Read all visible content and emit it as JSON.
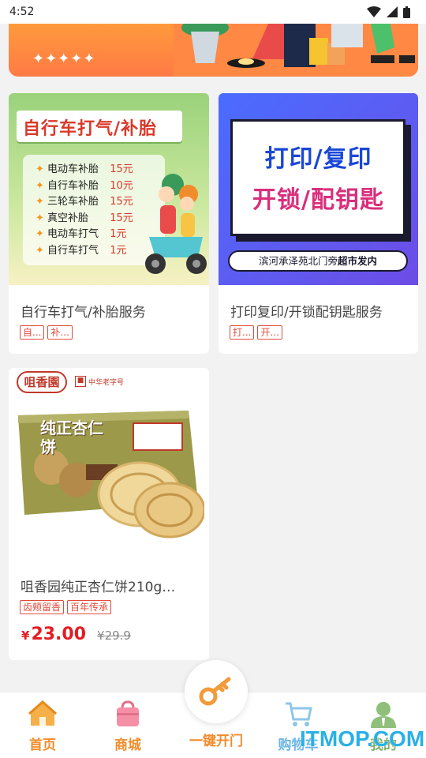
{
  "status_bar": {
    "time": "4:52"
  },
  "banner": {
    "decoration": "✦✦✦✦✦"
  },
  "products": [
    {
      "image_heading": "自行车打气/补胎",
      "price_list": [
        {
          "item": "电动车补胎",
          "price": "15元"
        },
        {
          "item": "自行车补胎",
          "price": "10元"
        },
        {
          "item": "三轮车补胎",
          "price": "15元"
        },
        {
          "item": "真空补胎",
          "price": "15元"
        },
        {
          "item": "电动车打气",
          "price": "1元"
        },
        {
          "item": "自行车打气",
          "price": "1元"
        }
      ],
      "title": "自行车打气/补胎服务",
      "tags": [
        "自...",
        "补..."
      ]
    },
    {
      "image_line1": "打印/复印",
      "image_line2": "开锁/配钥匙",
      "image_footer": "滨河承泽苑北门旁",
      "image_footer_bold": "超市发内",
      "title": "打印复印/开锁配钥匙服务",
      "tags": [
        "打...",
        "开..."
      ]
    },
    {
      "brand_logo": "咀香園",
      "brand_badge": "中华老字号",
      "box_text": "纯正杏仁饼",
      "title": "咀香园纯正杏仁饼210g…",
      "tags": [
        "齿颊留香",
        "百年传承"
      ],
      "currency": "¥",
      "price": "23.00",
      "old_price": "¥29.9"
    }
  ],
  "tabbar": {
    "items": [
      {
        "label": "首页",
        "icon": "home-icon",
        "color": "#f08c2c"
      },
      {
        "label": "商城",
        "icon": "shopping-bag-icon",
        "color": "#f08c2c"
      },
      {
        "label": "一键开门",
        "icon": "key-icon",
        "color": "#f08c2c"
      },
      {
        "label": "购物车",
        "icon": "cart-icon",
        "color": "#6cb6e6"
      },
      {
        "label": "我的",
        "icon": "profile-icon",
        "color": "#7fb06a"
      }
    ]
  },
  "watermark": "ITMOP.COM"
}
